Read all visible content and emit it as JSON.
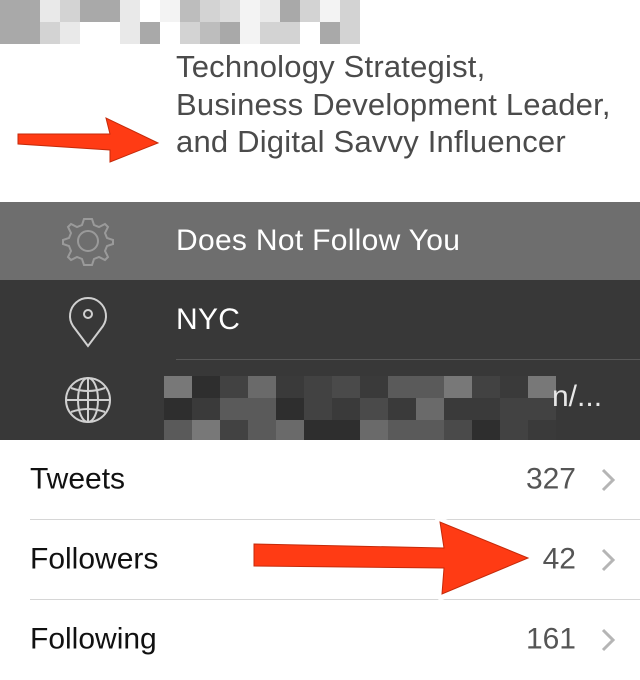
{
  "profile": {
    "bio_lines": [
      "Technology Strategist,",
      "Business Development Leader,",
      "and Digital Savvy Influencer"
    ]
  },
  "info_rows": [
    {
      "icon": "gear-icon",
      "label": "Does Not Follow You"
    },
    {
      "icon": "location-pin-icon",
      "label": "NYC"
    },
    {
      "icon": "globe-icon",
      "label_tail": "n/..."
    }
  ],
  "stats": [
    {
      "label": "Tweets",
      "count": "327"
    },
    {
      "label": "Followers",
      "count": "42"
    },
    {
      "label": "Following",
      "count": "161"
    }
  ],
  "colors": {
    "arrow": "#ff3b14",
    "follow_row_bg": "#6e6e6e",
    "dark_row_bg": "#383838",
    "stat_text": "#111111",
    "count_text": "#555555"
  }
}
